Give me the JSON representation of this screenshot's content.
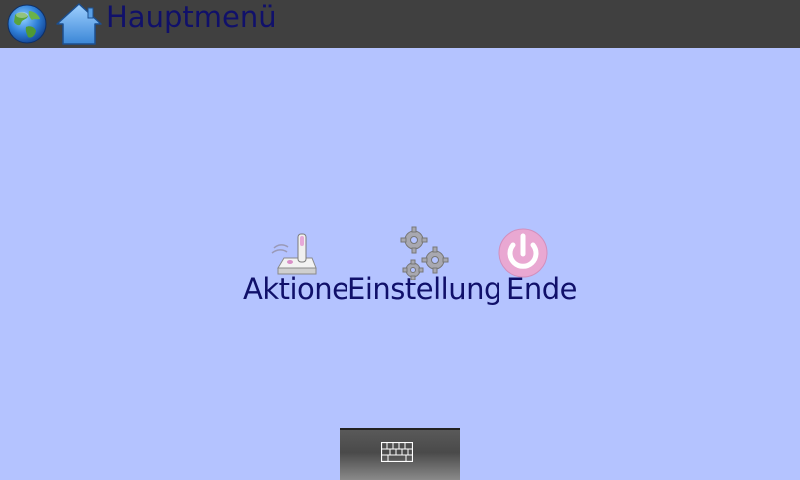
{
  "titlebar": {
    "title": "Hauptmenü",
    "icons": [
      "globe-icon",
      "home-icon"
    ],
    "background": "#404040",
    "title_color": "#10106a"
  },
  "menu": {
    "items": [
      {
        "label": "Aktionen",
        "icon": "joystick-icon"
      },
      {
        "label": "Einstellungen",
        "icon": "gears-icon"
      },
      {
        "label": "Ende",
        "icon": "power-icon"
      }
    ]
  },
  "bottombar": {
    "icon": "keyboard-icon"
  },
  "colors": {
    "background": "#b4c3ff",
    "text": "#10106a"
  }
}
